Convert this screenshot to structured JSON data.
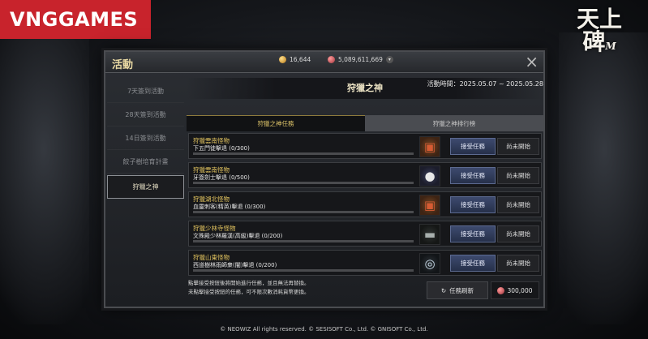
{
  "brand": {
    "vng_logo": "VNGGAMES",
    "game_logo": "天上碑",
    "game_logo_suffix": "M"
  },
  "window": {
    "title": "活動",
    "currency": {
      "gold": "16,644",
      "gems": "5,089,611,669"
    },
    "close_icon": "×"
  },
  "sidebar": {
    "items": [
      {
        "label": "7天簽到活動"
      },
      {
        "label": "28天簽到活動"
      },
      {
        "label": "14日簽到活動"
      },
      {
        "label": "餃子樹培育計畫"
      },
      {
        "label": "狩獵之神"
      }
    ],
    "active_index": 4
  },
  "main": {
    "event_title": "狩獵之神",
    "event_time": "活動時間：2025.05.07 ~ 2025.05.28",
    "tabs": [
      {
        "label": "狩獵之神任務"
      },
      {
        "label": "狩獵之神排行榜"
      }
    ],
    "missions": [
      {
        "category": "狩獵雲南怪物",
        "desc": "下五門徒擊退 (0/300)",
        "progress": 0,
        "icon": "chest-icon",
        "accept": "接受任務",
        "status": "尚未開始"
      },
      {
        "category": "狩獵雲南怪物",
        "desc": "牙簽劍士擊退 (0/500)",
        "progress": 0,
        "icon": "eggs-icon",
        "accept": "接受任務",
        "status": "尚未開始"
      },
      {
        "category": "狩獵湖北怪物",
        "desc": "血靈刺客(精英)擊退 (0/300)",
        "progress": 0,
        "icon": "chest-icon",
        "accept": "接受任務",
        "status": "尚未開始"
      },
      {
        "category": "狩獵少林寺怪物",
        "desc": "文殊殿少林羅漢(高級)擊退 (0/200)",
        "progress": 0,
        "icon": "bar-icon",
        "accept": "接受任務",
        "status": "尚未開始"
      },
      {
        "category": "狩獵山東怪物",
        "desc": "西道樹林雨師衆(闇)擊退 (0/200)",
        "progress": 0,
        "icon": "ring-icon",
        "accept": "接受任務",
        "status": "尚未開始"
      }
    ],
    "notes": [
      "點擊接受按鈕後將開始進行任務，並且無法再替換。",
      "未點擊接受按鈕的任務，可不限次數消耗貨幣更換。"
    ],
    "refresh_label": "任務刷新",
    "refresh_cost": "300,000"
  },
  "footer": "© NEOWIZ All rights reserved. © SESISOFT Co., Ltd. © GNISOFT Co., Ltd.",
  "colors": {
    "brand_red": "#c8232c",
    "gold_text": "#e3c45f",
    "accept_button": "#3d4a6e"
  }
}
